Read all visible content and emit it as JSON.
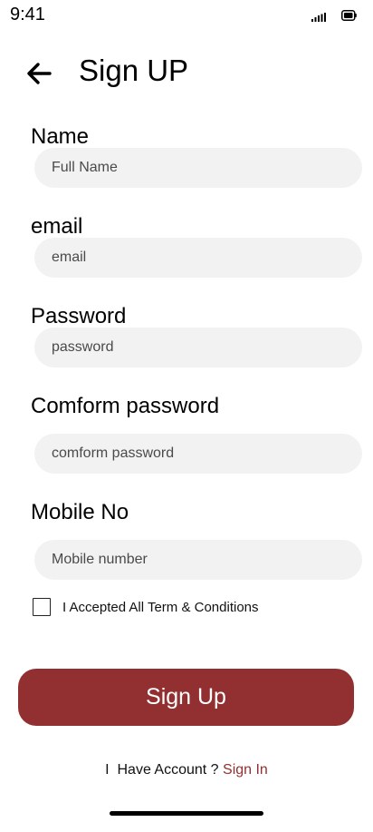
{
  "status_bar": {
    "time": "9:41",
    "signal_icon": "cellular-signal-icon",
    "battery_icon": "battery-icon"
  },
  "header": {
    "back_icon": "arrow-left-icon",
    "title": "Sign UP"
  },
  "form": {
    "name": {
      "label": "Name",
      "placeholder": "Full Name"
    },
    "email": {
      "label": "email",
      "placeholder": "email"
    },
    "password": {
      "label": "Password",
      "placeholder": "password"
    },
    "confirm_password": {
      "label": "Comform password",
      "placeholder": "comform password"
    },
    "mobile": {
      "label": "Mobile No",
      "placeholder": "Mobile number"
    },
    "terms": {
      "label": "I Accepted All Term & Conditions",
      "checked": false
    }
  },
  "actions": {
    "signup_label": "Sign Up"
  },
  "footer": {
    "prompt": "I  Have Account ? ",
    "signin_label": "Sign In"
  },
  "colors": {
    "accent": "#922f30",
    "input_background": "#f2f2f2",
    "text": "#000000"
  }
}
